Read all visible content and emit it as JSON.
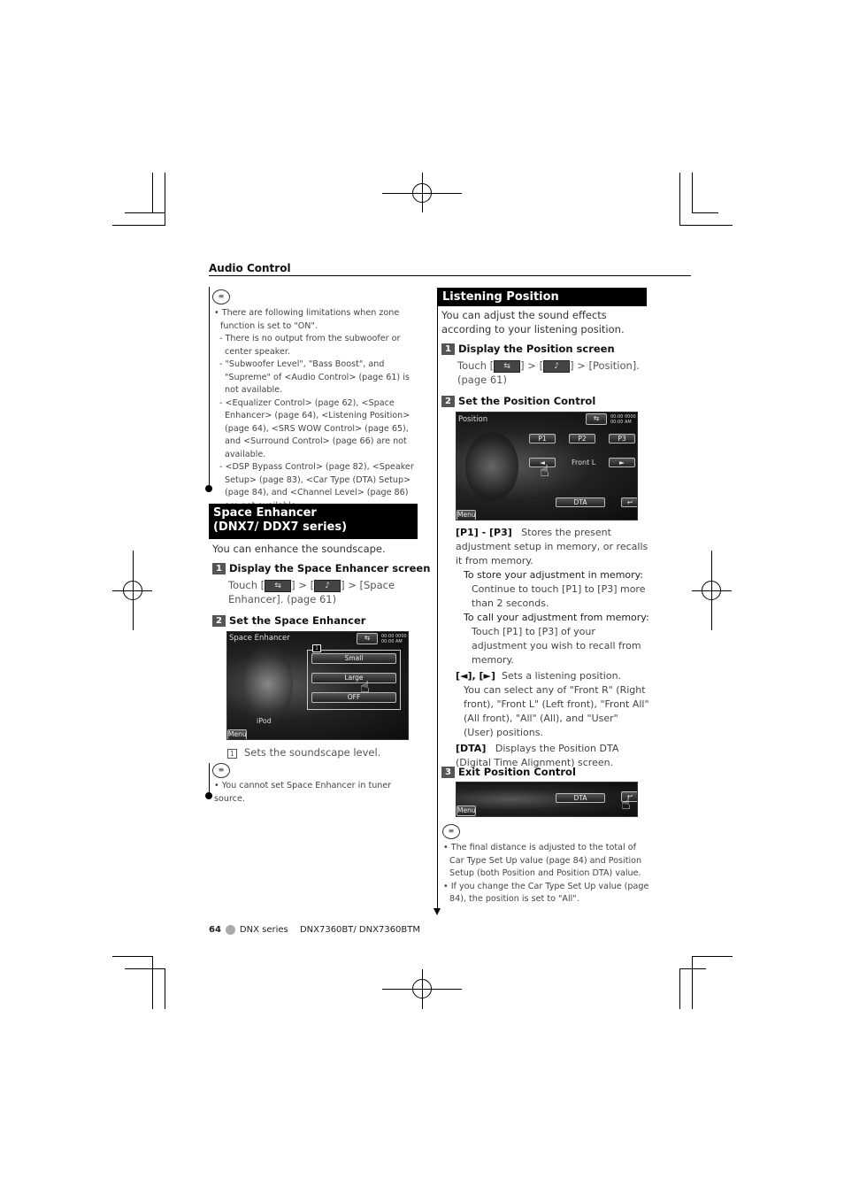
{
  "header": {
    "section": "Audio Control"
  },
  "left": {
    "note1": {
      "intro": "There are following limitations when zone function is set to \"ON\".",
      "items": [
        "- There is no output from the subwoofer or center speaker.",
        "- \"Subwoofer Level\", \"Bass Boost\", and \"Supreme\" of <Audio Control> (page 61) is not available.",
        "- <Equalizer Control> (page 62), <Space Enhancer> (page 64), <Listening Position> (page 64), <SRS WOW Control> (page 65), and <Surround Control> (page 66) are not available.",
        "- <DSP Bypass Control> (page 82), <Speaker Setup> (page 83), <Car Type (DTA) Setup> (page 84), and <Channel Level> (page 86) are not available."
      ]
    },
    "title_line1": "Space Enhancer",
    "title_line2": "(DNX7/ DDX7 series)",
    "intro": "You can enhance the soundscape.",
    "step1": {
      "num": "1",
      "label": "Display the Space Enhancer screen",
      "touch": "Touch [",
      "sep1": "] > [",
      "sep2": "] > [Space Enhancer]. (page 61)"
    },
    "step2": {
      "num": "2",
      "label": "Set the Space Enhancer"
    },
    "screen": {
      "title": "Space Enhancer",
      "clock": "00:00 0000\n00:00 AM",
      "marker": "1",
      "buttons": [
        "Small",
        "Large",
        "OFF"
      ],
      "source": "iPod",
      "menu": "Menu"
    },
    "legend": {
      "num": "1",
      "text": "Sets the soundscape level."
    },
    "note2": "You cannot set Space Enhancer in tuner source."
  },
  "right": {
    "title": "Listening Position",
    "intro": "You can adjust the sound effects according to your listening position.",
    "step1": {
      "num": "1",
      "label": "Display the Position screen",
      "touch": "Touch [",
      "sep1": "] > [",
      "sep2": "] > [Position].",
      "page": "(page 61)"
    },
    "step2": {
      "num": "2",
      "label": "Set the Position Control"
    },
    "screen": {
      "title": "Position",
      "clock": "00:00 0000\n00:00 AM",
      "presets": [
        "P1",
        "P2",
        "P3"
      ],
      "left": "◄",
      "right": "►",
      "position": "Front L",
      "dta": "DTA",
      "menu": "Menu"
    },
    "desc": {
      "p_key": "[P1] - [P3]",
      "p_text": "Stores the present adjustment setup in memory, or recalls it from memory.",
      "store_head": "To store your adjustment in memory:",
      "store_text": "Continue to touch [P1] to [P3] more than 2 seconds.",
      "recall_head": "To call your adjustment from memory:",
      "recall_text": "Touch [P1] to [P3] of your adjustment you wish to recall from memory.",
      "arrow_key": "[◄], [►]",
      "arrow_text": "Sets a listening position.",
      "arrow_more": "You can select any of \"Front R\" (Right front), \"Front L\" (Left front), \"Front All\" (All front), \"All\" (All), and \"User\" (User) positions.",
      "dta_key": "[DTA]",
      "dta_text": "Displays the Position DTA (Digital Time Alignment) screen."
    },
    "step3": {
      "num": "3",
      "label": "Exit Position Control"
    },
    "screen2": {
      "dta": "DTA",
      "menu": "Menu"
    },
    "notes": [
      "The final distance is adjusted to the total of Car Type Set Up value (page 84) and Position Setup (both Position and Position DTA) value.",
      "If you change the Car Type Set Up value (page 84), the position is set to \"All\"."
    ]
  },
  "footer": {
    "page": "64",
    "series": "DNX series",
    "models": "DNX7360BT/ DNX7360BTM"
  }
}
